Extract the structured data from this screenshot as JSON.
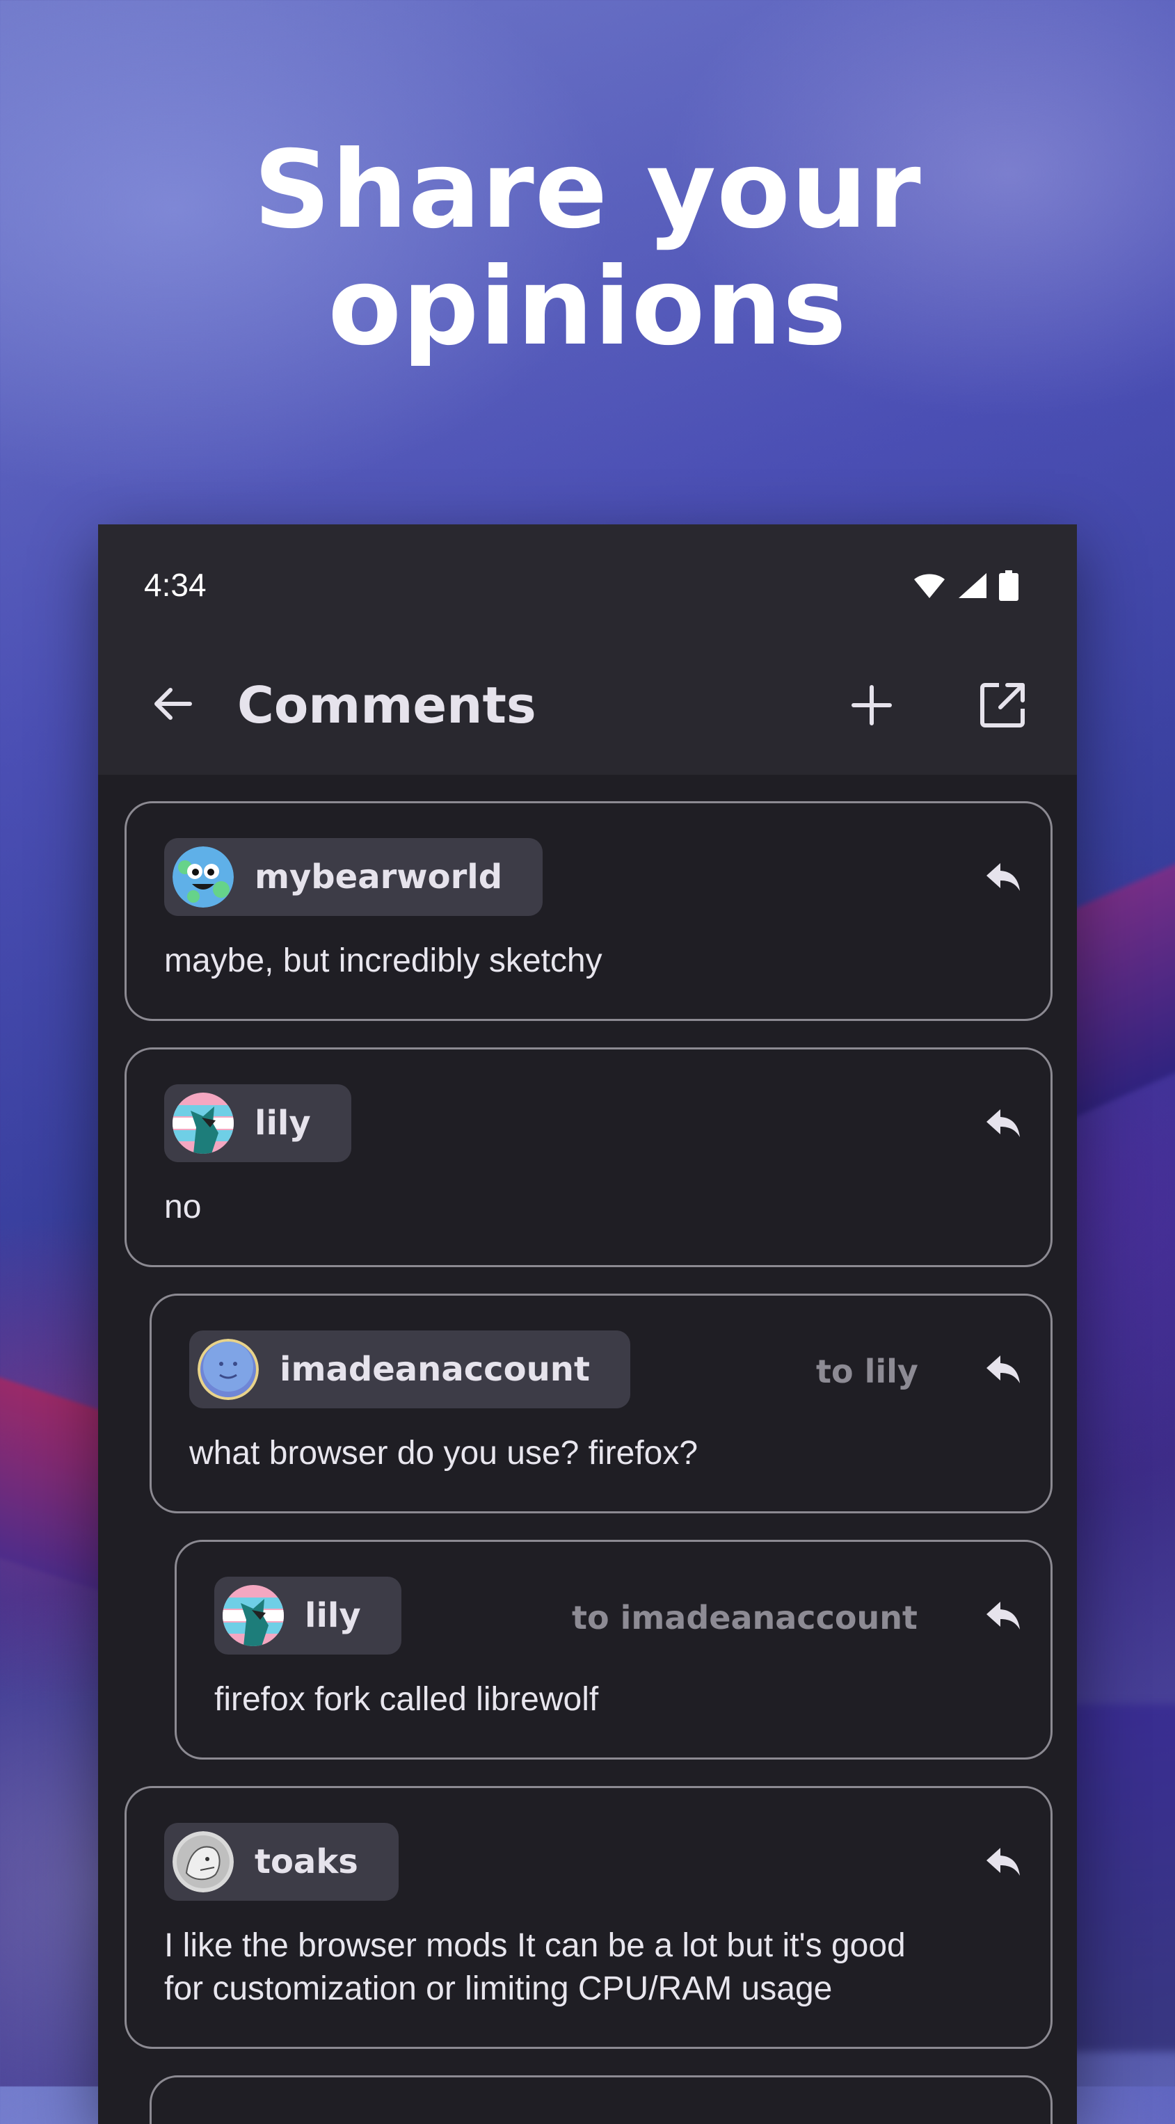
{
  "promo": {
    "headline_line1": "Share your",
    "headline_line2": "opinions"
  },
  "status_bar": {
    "time": "4:34",
    "icons": [
      "wifi-icon",
      "signal-icon",
      "battery-icon"
    ]
  },
  "app_bar": {
    "title": "Comments",
    "back_icon": "arrow-left-icon",
    "add_icon": "plus-icon",
    "open_icon": "open-in-new-icon"
  },
  "comments": [
    {
      "author": "mybearworld",
      "reply_to": "",
      "text": "maybe, but incredibly sketchy",
      "depth": 0
    },
    {
      "author": "lily",
      "reply_to": "",
      "text": "no",
      "depth": 0
    },
    {
      "author": "imadeanaccount",
      "reply_to": "to lily",
      "text": "what browser do you use? firefox?",
      "depth": 1
    },
    {
      "author": "lily",
      "reply_to": "to imadeanaccount",
      "text": "firefox fork called librewolf",
      "depth": 2
    },
    {
      "author": "toaks",
      "reply_to": "",
      "text_line1": "I like the browser mods It can be a lot but it's good",
      "text_line2": "for customization or limiting CPU/RAM usage",
      "depth": 0
    }
  ],
  "colors": {
    "surface": "#1f1e24",
    "bar": "#29282f",
    "chip": "#3d3c47",
    "outline": "#8c8a92",
    "muted_text": "#8d8b94"
  }
}
